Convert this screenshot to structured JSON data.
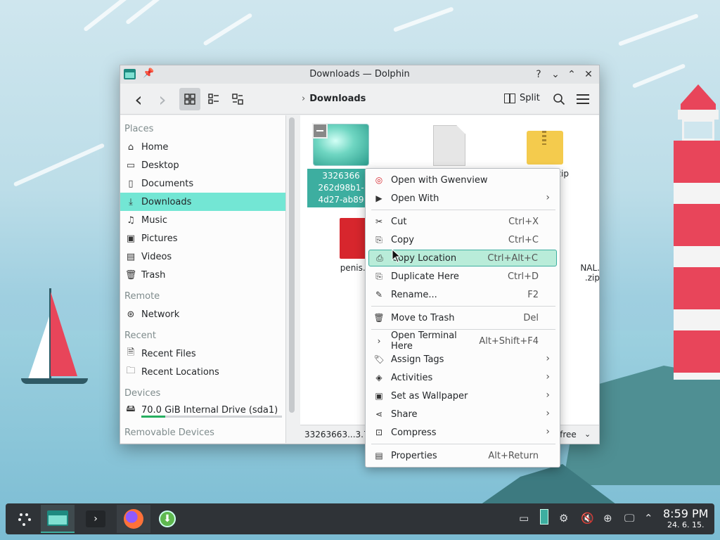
{
  "window": {
    "title": "Downloads — Dolphin",
    "help_glyph": "?",
    "min_glyph": "⌄",
    "max_glyph": "⌃",
    "close_glyph": "✕"
  },
  "toolbar": {
    "back_icon": "‹",
    "forward_icon": "›",
    "breadcrumb": "Downloads",
    "split_label": "Split"
  },
  "places": {
    "sections": [
      "Places",
      "Remote",
      "Recent",
      "Devices",
      "Removable Devices"
    ],
    "items": [
      {
        "label": "Home",
        "icon": "home-icon"
      },
      {
        "label": "Desktop",
        "icon": "desktop-icon"
      },
      {
        "label": "Documents",
        "icon": "documents-icon"
      },
      {
        "label": "Downloads",
        "icon": "downloads-icon",
        "selected": true
      },
      {
        "label": "Music",
        "icon": "music-icon"
      },
      {
        "label": "Pictures",
        "icon": "pictures-icon"
      },
      {
        "label": "Videos",
        "icon": "videos-icon"
      },
      {
        "label": "Trash",
        "icon": "trash-icon"
      },
      {
        "label": "Network",
        "icon": "network-icon"
      },
      {
        "label": "Recent Files",
        "icon": "recent-files-icon"
      },
      {
        "label": "Recent Locations",
        "icon": "recent-locations-icon"
      },
      {
        "label": "70.0 GiB Internal Drive (sda1)",
        "icon": "drive-icon"
      }
    ],
    "drive_usage_fraction": 0.17
  },
  "files": [
    {
      "name_lines": [
        "3326366",
        "262d98b1-",
        "4d27-ab89"
      ],
      "type": "image",
      "selected": true
    },
    {
      "name_lines": [
        ""
      ],
      "type": "document"
    },
    {
      "name_lines": [
        ".zip"
      ],
      "type": "zip"
    },
    {
      "name_lines": [
        "penis.c"
      ],
      "type": "pdf"
    },
    {
      "name_lines": [
        "NAL.",
        ".zip"
      ],
      "type": "zip"
    }
  ],
  "statusbar": {
    "left": "33263663...3.7",
    "right": "l free"
  },
  "context_menu": {
    "items": [
      {
        "label": "Open with Gwenview",
        "shortcut": "",
        "icon": "gwenview-icon",
        "submenu": false
      },
      {
        "label": "Open With",
        "shortcut": "",
        "icon": "open-with-icon",
        "submenu": true
      },
      {
        "label": "Cut",
        "shortcut": "Ctrl+X",
        "icon": "cut-icon",
        "submenu": false
      },
      {
        "label": "Copy",
        "shortcut": "Ctrl+C",
        "icon": "copy-icon",
        "submenu": false
      },
      {
        "label": "Copy Location",
        "shortcut": "Ctrl+Alt+C",
        "icon": "copy-location-icon",
        "submenu": false,
        "highlighted": true
      },
      {
        "label": "Duplicate Here",
        "shortcut": "Ctrl+D",
        "icon": "duplicate-icon",
        "submenu": false
      },
      {
        "label": "Rename...",
        "shortcut": "F2",
        "icon": "rename-icon",
        "submenu": false
      },
      {
        "label": "Move to Trash",
        "shortcut": "Del",
        "icon": "trash-icon",
        "submenu": false
      },
      {
        "label": "Open Terminal Here",
        "shortcut": "Alt+Shift+F4",
        "icon": "terminal-icon",
        "submenu": false
      },
      {
        "label": "Assign Tags",
        "shortcut": "",
        "icon": "tag-icon",
        "submenu": true
      },
      {
        "label": "Activities",
        "shortcut": "",
        "icon": "activities-icon",
        "submenu": true
      },
      {
        "label": "Set as Wallpaper",
        "shortcut": "",
        "icon": "wallpaper-icon",
        "submenu": true
      },
      {
        "label": "Share",
        "shortcut": "",
        "icon": "share-icon",
        "submenu": true
      },
      {
        "label": "Compress",
        "shortcut": "",
        "icon": "compress-icon",
        "submenu": true
      },
      {
        "label": "Properties",
        "shortcut": "Alt+Return",
        "icon": "properties-icon",
        "submenu": false
      }
    ],
    "submenu_arrow": "›"
  },
  "panel": {
    "time": "8:59 PM",
    "date": "24. 6. 15."
  }
}
